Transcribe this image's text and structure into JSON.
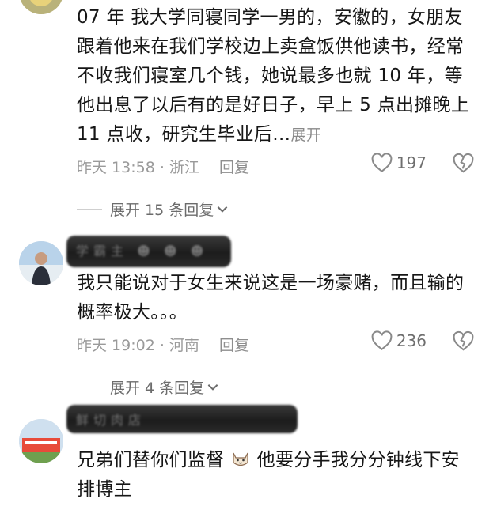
{
  "comments": [
    {
      "text": "07 年 我大学同寝同学一男的，安徽的，女朋友跟着他来在我们学校边上卖盒饭供他读书，经常不收我们寝室几个钱，她说最多也就 10 年，等他出息了以后有的是好日子，早上 5 点出摊晚上 11 点收，研究生毕业后…",
      "expand_label": "展开",
      "time_location": "昨天 13:58 · 浙江",
      "reply_label": "回复",
      "like_count": "197",
      "replies_label": "展开 15 条回复"
    },
    {
      "text": "我只能说对于女生来说这是一场豪赌，而且输的概率极大。。。",
      "time_location": "昨天 19:02 · 河南",
      "reply_label": "回复",
      "like_count": "236",
      "replies_label": "展开 4 条回复"
    },
    {
      "text_before_emoji": "兄弟们替你们监督",
      "text_after_emoji": "他要分手我分分钟线下安排博主",
      "emoji": "cat-face"
    }
  ],
  "colors": {
    "text": "#161616",
    "meta": "#9a9a9a",
    "icon": "#8a8a8a"
  }
}
